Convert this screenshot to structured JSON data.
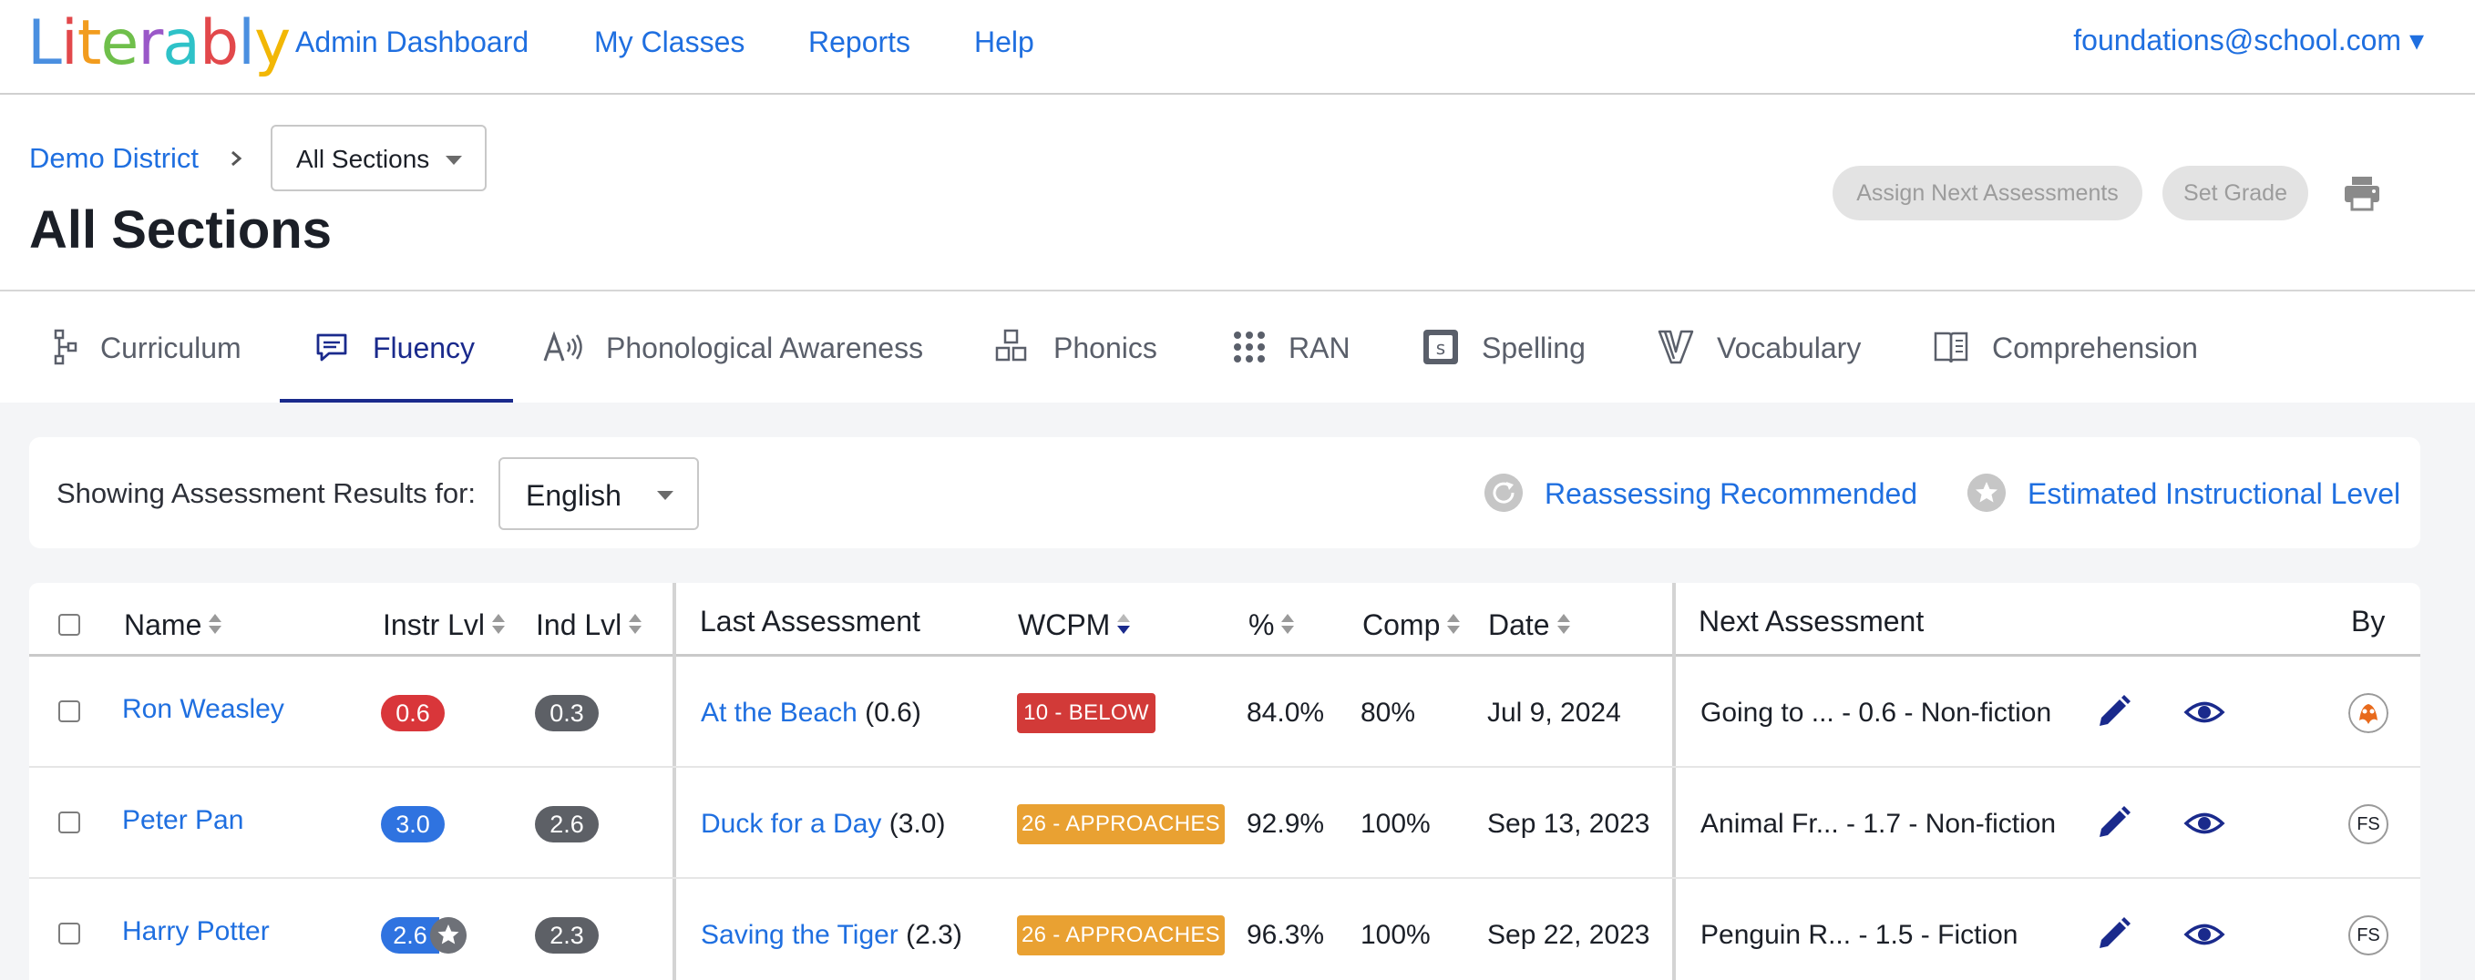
{
  "brand": {
    "letters": [
      {
        "ch": "L",
        "color": "#4a8fe0"
      },
      {
        "ch": "i",
        "color": "#e2484b"
      },
      {
        "ch": "t",
        "color": "#f29c1e"
      },
      {
        "ch": "e",
        "color": "#6fbf4b"
      },
      {
        "ch": "r",
        "color": "#9a58c8"
      },
      {
        "ch": "a",
        "color": "#2ec2c8"
      },
      {
        "ch": "b",
        "color": "#e2484b"
      },
      {
        "ch": "l",
        "color": "#4a8fe0"
      },
      {
        "ch": "y",
        "color": "#f2b705"
      }
    ]
  },
  "nav": {
    "links": [
      "Admin Dashboard",
      "My Classes",
      "Reports",
      "Help"
    ],
    "user": "foundations@school.com ▾"
  },
  "header": {
    "breadcrumb": "Demo District",
    "section_select": "All Sections",
    "title": "All Sections",
    "assign_btn": "Assign Next Assessments",
    "grade_btn": "Set Grade"
  },
  "tabs": [
    "Curriculum",
    "Fluency",
    "Phonological Awareness",
    "Phonics",
    "RAN",
    "Spelling",
    "Vocabulary",
    "Comprehension"
  ],
  "active_tab": "Fluency",
  "filter": {
    "label": "Showing Assessment Results for:",
    "language": "English",
    "legend_reassess": "Reassessing Recommended",
    "legend_instructional": "Estimated Instructional Level"
  },
  "table": {
    "columns": {
      "name": "Name",
      "instr": "Instr Lvl",
      "ind": "Ind Lvl",
      "last": "Last Assessment",
      "wcpm": "WCPM",
      "pct": "%",
      "comp": "Comp",
      "date": "Date",
      "next": "Next Assessment",
      "by": "By"
    },
    "rows": [
      {
        "name": "Ron Weasley",
        "instr": "0.6",
        "ind": "0.3",
        "last_title": "At the Beach",
        "last_level": "(0.6)",
        "wcpm": "10 - BELOW",
        "pct": "84.0%",
        "comp": "80%",
        "date": "Jul 9, 2024",
        "next": "Going to ... - 0.6 - Non-fiction",
        "by": ""
      },
      {
        "name": "Peter Pan",
        "instr": "3.0",
        "ind": "2.6",
        "last_title": "Duck for a Day",
        "last_level": "(3.0)",
        "wcpm": "26 - APPROACHES",
        "pct": "92.9%",
        "comp": "100%",
        "date": "Sep 13, 2023",
        "next": "Animal Fr... - 1.7 - Non-fiction",
        "by": "FS"
      },
      {
        "name": "Harry Potter",
        "instr": "2.6",
        "ind": "2.3",
        "last_title": "Saving the Tiger",
        "last_level": "(2.3)",
        "wcpm": "26 - APPROACHES",
        "pct": "96.3%",
        "comp": "100%",
        "date": "Sep 22, 2023",
        "next": "Penguin R... - 1.5 - Fiction",
        "by": "FS"
      }
    ]
  },
  "colors": {
    "link": "#1f6fe0",
    "active_tab": "#1a2a8c",
    "below": "#d23a38",
    "approaches": "#e9a132"
  },
  "icons": {
    "tabs": [
      "curriculum-tree-icon",
      "chat-bubble-icon",
      "phonological-sound-icon",
      "phonics-blocks-icon",
      "dots-grid-icon",
      "spelling-s-icon",
      "vocabulary-v-icon",
      "book-icon"
    ],
    "row_actions": [
      "pencil-icon",
      "eye-icon"
    ]
  }
}
